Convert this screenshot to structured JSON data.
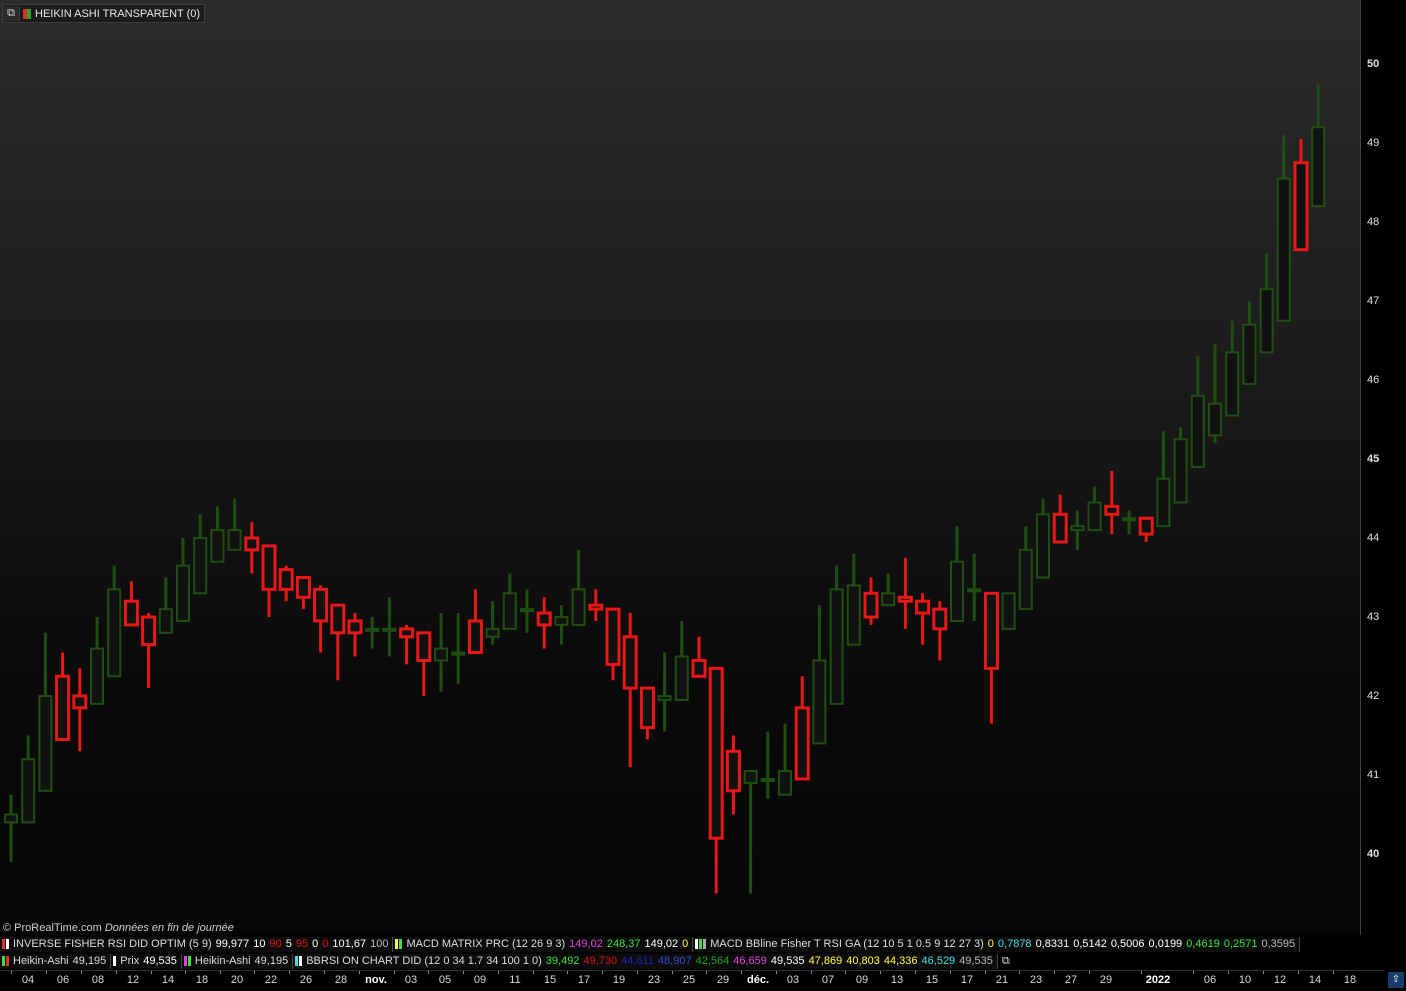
{
  "title": "HEIKIN ASHI TRANSPARENT (0)",
  "copyright": "© ProRealTime.com",
  "data_note": "Données en fin de journée",
  "colors": {
    "up": "#1f4f10",
    "down": "#e81818",
    "bg_top": "#2b2b2b",
    "bg_bottom": "#060606"
  },
  "indicators_row1": [
    {
      "label": "INVERSE FISHER RSI DID OPTIM (5 9)",
      "values": [
        {
          "t": "99,977",
          "c": "#ffffff"
        },
        {
          "t": "10",
          "c": "#ffffff"
        },
        {
          "t": "90",
          "c": "#e01010"
        },
        {
          "t": "5",
          "c": "#ffffff"
        },
        {
          "t": "95",
          "c": "#e01010"
        },
        {
          "t": "0",
          "c": "#ffffff"
        },
        {
          "t": "0",
          "c": "#e01010"
        },
        {
          "t": "101,67",
          "c": "#ffffff"
        },
        {
          "t": "100",
          "c": "#bbbbbb"
        }
      ]
    },
    {
      "label": "MACD MATRIX PRC (12 26 9 3)",
      "values": [
        {
          "t": "149,02",
          "c": "#e040e0"
        },
        {
          "t": "248,37",
          "c": "#40e040"
        },
        {
          "t": "149,02",
          "c": "#ffffff"
        },
        {
          "t": "0",
          "c": "#ffff40"
        }
      ]
    },
    {
      "label": "MACD  BBline  Fisher T RSI  GA (12 10 5 1 0.5 9 12 27 3)",
      "values": [
        {
          "t": "0",
          "c": "#ffff40"
        },
        {
          "t": "0,7878",
          "c": "#40e0e0"
        },
        {
          "t": "0,8331",
          "c": "#ffffff"
        },
        {
          "t": "0,5142",
          "c": "#ffffff"
        },
        {
          "t": "0,5006",
          "c": "#ffffff"
        },
        {
          "t": "0,0199",
          "c": "#ffffff"
        },
        {
          "t": "0,4619",
          "c": "#40e040"
        },
        {
          "t": "0,2571",
          "c": "#40e040"
        },
        {
          "t": "0,3595",
          "c": "#bbbbbb"
        }
      ]
    }
  ],
  "indicators_row2": [
    {
      "label": "Heikin-Ashi",
      "values": [
        {
          "t": "49,195",
          "c": "#dddddd"
        }
      ]
    },
    {
      "label": "Prix",
      "values": [
        {
          "t": "49,535",
          "c": "#ffffff"
        }
      ]
    },
    {
      "label": "Heikin-Ashi",
      "values": [
        {
          "t": "49,195",
          "c": "#dddddd"
        }
      ]
    },
    {
      "label": "BBRSI ON CHART DID (12 0 34 1.7 34 100 1 0)",
      "values": [
        {
          "t": "39,492",
          "c": "#40e040"
        },
        {
          "t": "49,730",
          "c": "#e01010"
        },
        {
          "t": "44,611",
          "c": "#2020c0"
        },
        {
          "t": "48,907",
          "c": "#3050d0"
        },
        {
          "t": "42,564",
          "c": "#20a020"
        },
        {
          "t": "46,659",
          "c": "#e040e0"
        },
        {
          "t": "49,535",
          "c": "#ffffff"
        },
        {
          "t": "47,869",
          "c": "#ffff40"
        },
        {
          "t": "40,803",
          "c": "#ffff40"
        },
        {
          "t": "44,336",
          "c": "#ffff40"
        },
        {
          "t": "46,529",
          "c": "#40e0e0"
        },
        {
          "t": "49,535",
          "c": "#bbbbbb"
        }
      ]
    }
  ],
  "x_axis_labels": [
    {
      "t": "04",
      "b": false
    },
    {
      "t": "06",
      "b": false
    },
    {
      "t": "08",
      "b": false
    },
    {
      "t": "12",
      "b": false
    },
    {
      "t": "14",
      "b": false
    },
    {
      "t": "18",
      "b": false
    },
    {
      "t": "20",
      "b": false
    },
    {
      "t": "22",
      "b": false
    },
    {
      "t": "26",
      "b": false
    },
    {
      "t": "28",
      "b": false
    },
    {
      "t": "nov.",
      "b": true
    },
    {
      "t": "03",
      "b": false
    },
    {
      "t": "05",
      "b": false
    },
    {
      "t": "09",
      "b": false
    },
    {
      "t": "11",
      "b": false
    },
    {
      "t": "15",
      "b": false
    },
    {
      "t": "17",
      "b": false
    },
    {
      "t": "19",
      "b": false
    },
    {
      "t": "23",
      "b": false
    },
    {
      "t": "25",
      "b": false
    },
    {
      "t": "29",
      "b": false
    },
    {
      "t": "déc.",
      "b": true
    },
    {
      "t": "03",
      "b": false
    },
    {
      "t": "07",
      "b": false
    },
    {
      "t": "09",
      "b": false
    },
    {
      "t": "13",
      "b": false
    },
    {
      "t": "15",
      "b": false
    },
    {
      "t": "17",
      "b": false
    },
    {
      "t": "21",
      "b": false
    },
    {
      "t": "23",
      "b": false
    },
    {
      "t": "27",
      "b": false
    },
    {
      "t": "29",
      "b": false
    },
    {
      "t": "2022",
      "b": true
    },
    {
      "t": "06",
      "b": false
    },
    {
      "t": "10",
      "b": false
    },
    {
      "t": "12",
      "b": false
    },
    {
      "t": "14",
      "b": false
    },
    {
      "t": "18",
      "b": false
    }
  ],
  "chart_data": {
    "type": "candlestick",
    "title": "HEIKIN ASHI TRANSPARENT (0)",
    "ylim": [
      39.0,
      50.6
    ],
    "y_ticks": [
      40,
      41,
      42,
      43,
      44,
      45,
      46,
      47,
      48,
      49,
      50
    ],
    "y_ticks_bold": [
      40,
      45,
      50
    ],
    "candles": [
      {
        "o": 40.4,
        "c": 40.5,
        "h": 40.75,
        "l": 39.9
      },
      {
        "o": 40.4,
        "c": 41.2,
        "h": 41.5,
        "l": 40.4
      },
      {
        "o": 40.8,
        "c": 42.0,
        "h": 42.8,
        "l": 40.8
      },
      {
        "o": 42.25,
        "c": 41.45,
        "h": 42.55,
        "l": 41.45
      },
      {
        "o": 42.0,
        "c": 41.85,
        "h": 42.35,
        "l": 41.3
      },
      {
        "o": 41.9,
        "c": 42.6,
        "h": 43.0,
        "l": 41.9
      },
      {
        "o": 42.25,
        "c": 43.35,
        "h": 43.65,
        "l": 42.25
      },
      {
        "o": 43.2,
        "c": 42.9,
        "h": 43.45,
        "l": 42.9
      },
      {
        "o": 43.0,
        "c": 42.65,
        "h": 43.05,
        "l": 42.1
      },
      {
        "o": 42.8,
        "c": 43.1,
        "h": 43.5,
        "l": 42.8
      },
      {
        "o": 42.95,
        "c": 43.65,
        "h": 44.0,
        "l": 42.95
      },
      {
        "o": 43.3,
        "c": 44.0,
        "h": 44.3,
        "l": 43.3
      },
      {
        "o": 43.7,
        "c": 44.1,
        "h": 44.4,
        "l": 43.7
      },
      {
        "o": 43.85,
        "c": 44.1,
        "h": 44.5,
        "l": 43.85
      },
      {
        "o": 44.0,
        "c": 43.85,
        "h": 44.2,
        "l": 43.55
      },
      {
        "o": 43.9,
        "c": 43.35,
        "h": 43.9,
        "l": 43.0
      },
      {
        "o": 43.6,
        "c": 43.35,
        "h": 43.65,
        "l": 43.2
      },
      {
        "o": 43.5,
        "c": 43.25,
        "h": 43.5,
        "l": 43.1
      },
      {
        "o": 43.35,
        "c": 42.95,
        "h": 43.4,
        "l": 42.55
      },
      {
        "o": 43.15,
        "c": 42.8,
        "h": 43.1,
        "l": 42.2
      },
      {
        "o": 42.95,
        "c": 42.8,
        "h": 43.05,
        "l": 42.5
      },
      {
        "o": 42.85,
        "c": 42.85,
        "h": 43.0,
        "l": 42.6
      },
      {
        "o": 42.85,
        "c": 42.85,
        "h": 43.25,
        "l": 42.5
      },
      {
        "o": 42.85,
        "c": 42.75,
        "h": 42.9,
        "l": 42.4
      },
      {
        "o": 42.8,
        "c": 42.45,
        "h": 42.8,
        "l": 42.0
      },
      {
        "o": 42.45,
        "c": 42.6,
        "h": 43.05,
        "l": 42.05
      },
      {
        "o": 42.55,
        "c": 42.55,
        "h": 43.05,
        "l": 42.15
      },
      {
        "o": 42.95,
        "c": 42.55,
        "h": 43.35,
        "l": 42.55
      },
      {
        "o": 42.75,
        "c": 42.85,
        "h": 43.2,
        "l": 42.65
      },
      {
        "o": 42.85,
        "c": 43.3,
        "h": 43.55,
        "l": 42.85
      },
      {
        "o": 43.1,
        "c": 43.1,
        "h": 43.35,
        "l": 42.8
      },
      {
        "o": 43.05,
        "c": 42.9,
        "h": 43.25,
        "l": 42.6
      },
      {
        "o": 42.9,
        "c": 43.0,
        "h": 43.15,
        "l": 42.65
      },
      {
        "o": 42.9,
        "c": 43.35,
        "h": 43.85,
        "l": 42.9
      },
      {
        "o": 43.15,
        "c": 43.1,
        "h": 43.35,
        "l": 42.95
      },
      {
        "o": 43.1,
        "c": 42.4,
        "h": 43.1,
        "l": 42.2
      },
      {
        "o": 42.75,
        "c": 42.1,
        "h": 43.05,
        "l": 41.1
      },
      {
        "o": 42.1,
        "c": 41.6,
        "h": 42.1,
        "l": 41.45
      },
      {
        "o": 41.95,
        "c": 42.0,
        "h": 42.55,
        "l": 41.55
      },
      {
        "o": 41.95,
        "c": 42.5,
        "h": 42.95,
        "l": 41.95
      },
      {
        "o": 42.45,
        "c": 42.25,
        "h": 42.75,
        "l": 42.25
      },
      {
        "o": 42.35,
        "c": 40.2,
        "h": 42.35,
        "l": 39.5
      },
      {
        "o": 41.3,
        "c": 40.8,
        "h": 41.5,
        "l": 40.5
      },
      {
        "o": 40.9,
        "c": 41.05,
        "h": 41.05,
        "l": 39.5
      },
      {
        "o": 40.95,
        "c": 40.95,
        "h": 41.55,
        "l": 40.7
      },
      {
        "o": 40.75,
        "c": 41.05,
        "h": 41.65,
        "l": 40.75
      },
      {
        "o": 41.85,
        "c": 40.95,
        "h": 42.25,
        "l": 40.95
      },
      {
        "o": 41.4,
        "c": 42.45,
        "h": 43.15,
        "l": 41.4
      },
      {
        "o": 41.9,
        "c": 43.35,
        "h": 43.65,
        "l": 41.9
      },
      {
        "o": 42.65,
        "c": 43.4,
        "h": 43.8,
        "l": 42.65
      },
      {
        "o": 43.3,
        "c": 43.0,
        "h": 43.5,
        "l": 42.9
      },
      {
        "o": 43.15,
        "c": 43.3,
        "h": 43.55,
        "l": 43.15
      },
      {
        "o": 43.25,
        "c": 43.2,
        "h": 43.75,
        "l": 42.85
      },
      {
        "o": 43.2,
        "c": 43.05,
        "h": 43.3,
        "l": 42.65
      },
      {
        "o": 43.1,
        "c": 42.85,
        "h": 43.2,
        "l": 42.45
      },
      {
        "o": 42.95,
        "c": 43.7,
        "h": 44.15,
        "l": 42.95
      },
      {
        "o": 43.35,
        "c": 43.35,
        "h": 43.8,
        "l": 42.95
      },
      {
        "o": 43.3,
        "c": 42.35,
        "h": 43.3,
        "l": 41.65
      },
      {
        "o": 42.85,
        "c": 43.3,
        "h": 43.3,
        "l": 42.85
      },
      {
        "o": 43.1,
        "c": 43.85,
        "h": 44.15,
        "l": 43.1
      },
      {
        "o": 43.5,
        "c": 44.3,
        "h": 44.5,
        "l": 43.5
      },
      {
        "o": 44.3,
        "c": 43.95,
        "h": 44.55,
        "l": 43.95
      },
      {
        "o": 44.1,
        "c": 44.15,
        "h": 44.35,
        "l": 43.85
      },
      {
        "o": 44.1,
        "c": 44.45,
        "h": 44.65,
        "l": 44.1
      },
      {
        "o": 44.4,
        "c": 44.3,
        "h": 44.85,
        "l": 44.05
      },
      {
        "o": 44.25,
        "c": 44.25,
        "h": 44.35,
        "l": 44.05
      },
      {
        "o": 44.25,
        "c": 44.05,
        "h": 44.25,
        "l": 43.95
      },
      {
        "o": 44.15,
        "c": 44.75,
        "h": 45.35,
        "l": 44.15
      },
      {
        "o": 44.45,
        "c": 45.25,
        "h": 45.4,
        "l": 44.45
      },
      {
        "o": 44.9,
        "c": 45.8,
        "h": 46.3,
        "l": 44.9
      },
      {
        "o": 45.3,
        "c": 45.7,
        "h": 46.45,
        "l": 45.2
      },
      {
        "o": 45.55,
        "c": 46.35,
        "h": 46.75,
        "l": 45.55
      },
      {
        "o": 45.95,
        "c": 46.7,
        "h": 47.0,
        "l": 45.95
      },
      {
        "o": 46.35,
        "c": 47.15,
        "h": 47.6,
        "l": 46.35
      },
      {
        "o": 46.75,
        "c": 48.55,
        "h": 49.1,
        "l": 46.75
      },
      {
        "o": 48.75,
        "c": 47.65,
        "h": 49.05,
        "l": 47.65
      },
      {
        "o": 48.2,
        "c": 49.2,
        "h": 49.75,
        "l": 48.2
      }
    ]
  }
}
